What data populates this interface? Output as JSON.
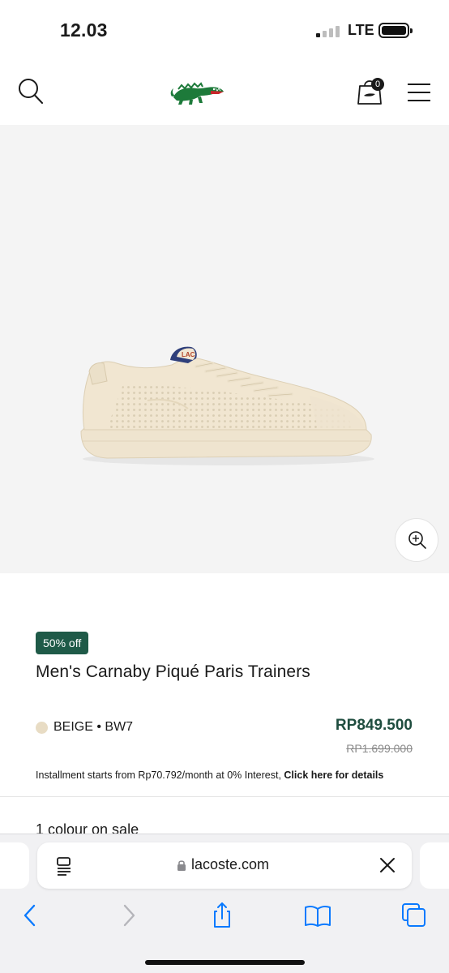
{
  "status_bar": {
    "time": "12.03",
    "network": "LTE"
  },
  "header": {
    "search_icon": "search-icon",
    "logo": "lacoste-crocodile-logo",
    "bag_icon": "shopping-bag-icon",
    "bag_count": "0",
    "menu_icon": "hamburger-menu-icon"
  },
  "product": {
    "image": "beige-knit-sneaker",
    "zoom_icon": "zoom-in-icon",
    "discount_badge": "50% off",
    "title": "Men's Carnaby Piqué Paris Trainers",
    "colour": "BEIGE • BW7",
    "price_current": "RP849.500",
    "price_old": "RP1.699.000",
    "installment_text": "Installment starts from Rp70.792/month at 0% Interest, ",
    "installment_link": "Click here for details",
    "colours_on_sale": "1 colour on sale"
  },
  "browser": {
    "domain": "lacoste.com",
    "toolbar": [
      "back-icon",
      "forward-icon",
      "share-icon",
      "bookmarks-icon",
      "tabs-icon"
    ]
  },
  "colors": {
    "brand_green": "#1f5a48",
    "price_green": "#1f4d3f",
    "image_bg": "#f4f4f4",
    "safari_blue": "#0a7aff"
  }
}
